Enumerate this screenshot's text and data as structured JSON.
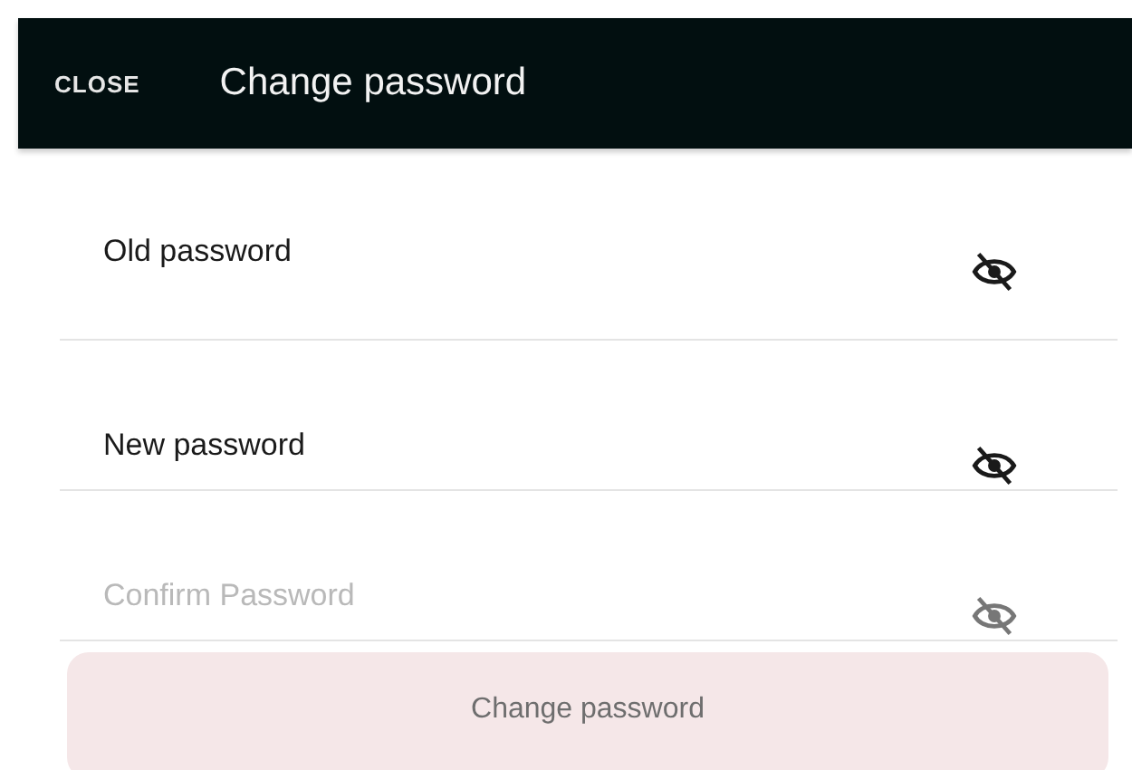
{
  "header": {
    "close": "CLOSE",
    "title": "Change password"
  },
  "fields": [
    {
      "label": "Old password",
      "disabled": false
    },
    {
      "label": "New password",
      "disabled": false
    },
    {
      "label": "Confirm Password",
      "disabled": true
    }
  ],
  "submit": {
    "label": "Change password",
    "disabled": true
  }
}
